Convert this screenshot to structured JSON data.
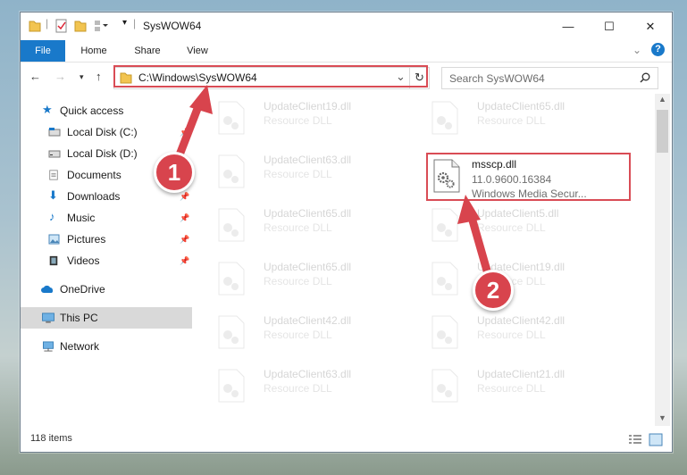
{
  "titlebar": {
    "title": "SysWOW64",
    "controls": {
      "minimize": "—",
      "maximize": "☐",
      "close": "✕"
    }
  },
  "ribbon": {
    "tabs": [
      "File",
      "Home",
      "Share",
      "View"
    ],
    "expand_icon": "chevron-down-icon",
    "help_icon": "?"
  },
  "address": {
    "path": "C:\\Windows\\SysWOW64",
    "refresh": "↻",
    "dropdown": "⌄"
  },
  "search": {
    "placeholder": "Search SysWOW64"
  },
  "sidebar": {
    "items": [
      {
        "label": "Quick access",
        "icon": "star-icon"
      },
      {
        "label": "Local Disk (C:)",
        "icon": "drive-icon"
      },
      {
        "label": "Local Disk (D:)",
        "icon": "drive-icon"
      },
      {
        "label": "Documents",
        "icon": "documents-icon"
      },
      {
        "label": "Downloads",
        "icon": "download-icon"
      },
      {
        "label": "Music",
        "icon": "music-icon"
      },
      {
        "label": "Pictures",
        "icon": "pictures-icon"
      },
      {
        "label": "Videos",
        "icon": "videos-icon"
      },
      {
        "label": "OneDrive",
        "icon": "cloud-icon"
      },
      {
        "label": "This PC",
        "icon": "computer-icon"
      },
      {
        "label": "Network",
        "icon": "network-icon"
      }
    ],
    "selected": "This PC"
  },
  "files": [
    {
      "name": "UpdateClient19.dll",
      "type": "Resource DLL"
    },
    {
      "name": "UpdateClient65.dll",
      "type": "Resource DLL"
    },
    {
      "name": "UpdateClient63.dll",
      "type": "Resource DLL"
    },
    {
      "name": "msscp.dll",
      "version": "11.0.9600.16384",
      "description": "Windows Media Secur...",
      "highlighted": true
    },
    {
      "name": "UpdateClient65.dll",
      "type": "Resource DLL"
    },
    {
      "name": "UpdateClient5.dll",
      "type": "Resource DLL"
    },
    {
      "name": "UpdateClient65.dll",
      "type": "Resource DLL"
    },
    {
      "name": "UpdateClient19.dll",
      "type": "Resource DLL"
    },
    {
      "name": "UpdateClient42.dll",
      "type": "Resource DLL"
    },
    {
      "name": "UpdateClient42.dll",
      "type": "Resource DLL"
    },
    {
      "name": "UpdateClient63.dll",
      "type": "Resource DLL"
    },
    {
      "name": "UpdateClient21.dll",
      "type": "Resource DLL"
    }
  ],
  "status": {
    "item_count": "118 items"
  },
  "callouts": {
    "one": "1",
    "two": "2"
  },
  "colors": {
    "accent": "#1979ca",
    "highlight": "#d94c55"
  }
}
